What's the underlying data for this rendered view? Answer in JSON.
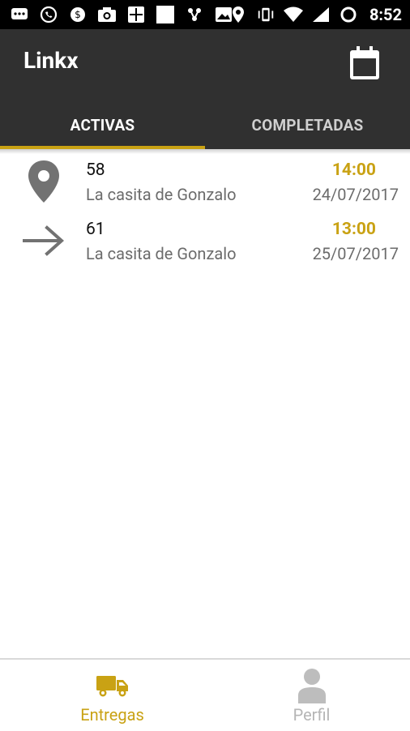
{
  "status_bar": {
    "time": "8:52",
    "left_icons": [
      "message-icon",
      "whatsapp-icon",
      "clock-dollar-icon",
      "camera-icon",
      "calculator-icon",
      "white-square-icon",
      "bluetooth-hub-icon",
      "image-icon"
    ],
    "right_icons": [
      "location-icon",
      "vibrate-icon",
      "wifi-icon",
      "signal-icon",
      "sync-icon"
    ]
  },
  "app": {
    "title": "Linkx",
    "calendar_icon": "calendar-icon",
    "accent_color": "#c9a214",
    "appbar_color": "#303030"
  },
  "tabs": [
    {
      "label": "ACTIVAS",
      "active": true
    },
    {
      "label": "COMPLETADAS",
      "active": false
    }
  ],
  "deliveries": [
    {
      "icon": "location-pin-icon",
      "number": "58",
      "place": "La casita de Gonzalo",
      "time": "14:00",
      "date": "24/07/2017"
    },
    {
      "icon": "arrow-right-icon",
      "number": "61",
      "place": "La casita de Gonzalo",
      "time": "13:00",
      "date": "25/07/2017"
    }
  ],
  "bottom_nav": [
    {
      "label": "Entregas",
      "icon": "truck-icon",
      "active": true
    },
    {
      "label": "Perfil",
      "icon": "person-icon",
      "active": false
    }
  ]
}
